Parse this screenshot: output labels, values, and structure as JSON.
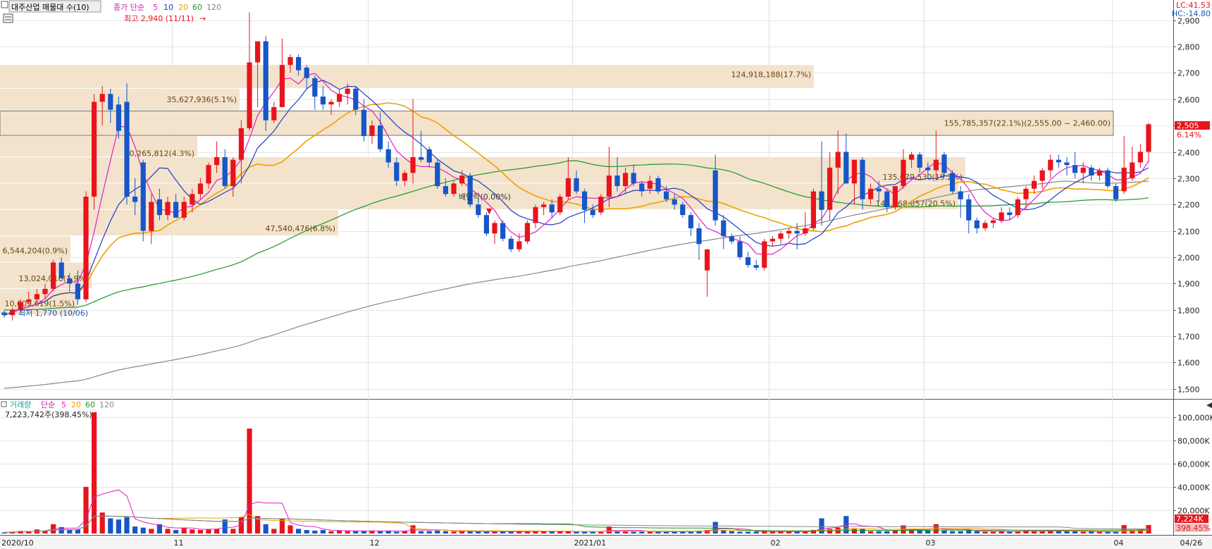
{
  "header": {
    "title": "대주산업 매물대 수(10)",
    "ma_prefix": "종가 단순",
    "ma_periods": [
      "5",
      "10",
      "20",
      "60",
      "120"
    ],
    "high_label": "최고 2,940 (11/11)",
    "low_label": "최저 1,770 (10/06)",
    "lc": "LC:41.53",
    "hc": "HC:-14.80",
    "dividend": "배당락(0.00%)"
  },
  "volume_header": {
    "label": "거래량",
    "ma_prefix": "단순",
    "ma_periods": [
      "5",
      "20",
      "60",
      "120"
    ],
    "last": "7,223,742주(398.45%)"
  },
  "price_axis": {
    "ticks": [
      "2,900",
      "2,800",
      "2,700",
      "2,600",
      "2,500",
      "2,400",
      "2,300",
      "2,200",
      "2,100",
      "2,000",
      "1,900",
      "1,800",
      "1,700",
      "1,600",
      "1,500"
    ],
    "current_price": "2,505",
    "current_change": "6.14%"
  },
  "volume_axis": {
    "ticks": [
      "100,000K",
      "80,000K",
      "60,000K",
      "40,000K",
      "20,000K"
    ],
    "current_volume": "7,224K",
    "current_ratio": "398.45%"
  },
  "time_axis": [
    "2020/10",
    "11",
    "12",
    "2021/01",
    "02",
    "03",
    "04",
    "04/26"
  ],
  "volume_profile": [
    {
      "label": "124,918,188(17.7%)"
    },
    {
      "label": "155,785,357(22.1%)(2,555.00 ~ 2,460.00)"
    },
    {
      "label": "35,627,936(5.1%)"
    },
    {
      "label": "30,265,812(4.3%)"
    },
    {
      "label": "135,079,530(19.2%)"
    },
    {
      "label": "144,568,857(20.5%)"
    },
    {
      "label": "47,540,476(6.8%)"
    },
    {
      "label": "6,544,204(0.9%)"
    },
    {
      "label": "13,024,016(1.9%)"
    },
    {
      "label": "10,609,619(1.5%)"
    }
  ],
  "colors": {
    "up": "#e8141c",
    "down": "#1656c8",
    "ma5": "#e020c8",
    "ma10": "#1e3cc8",
    "ma20": "#f0a000",
    "ma60": "#1a9a2a",
    "ma120": "#888888",
    "profile": "#f3e3cc"
  },
  "chart_data": {
    "type": "candlestick",
    "price_range": [
      1470,
      2950
    ],
    "volume_range_k": [
      0,
      110000
    ],
    "candles": [
      [
        1790,
        1800,
        1770,
        1780
      ],
      [
        1780,
        1810,
        1760,
        1800
      ],
      [
        1800,
        1840,
        1790,
        1830
      ],
      [
        1830,
        1870,
        1820,
        1840
      ],
      [
        1840,
        1880,
        1830,
        1860
      ],
      [
        1860,
        1900,
        1840,
        1880
      ],
      [
        1880,
        1990,
        1870,
        1980
      ],
      [
        1980,
        2000,
        1920,
        1920
      ],
      [
        1920,
        1940,
        1870,
        1900
      ],
      [
        1900,
        1950,
        1820,
        1840
      ],
      [
        1840,
        2250,
        1830,
        2230
      ],
      [
        2230,
        2620,
        2180,
        2590
      ],
      [
        2590,
        2650,
        2500,
        2620
      ],
      [
        2620,
        2640,
        2510,
        2560
      ],
      [
        2580,
        2610,
        2450,
        2480
      ],
      [
        2590,
        2660,
        2200,
        2230
      ],
      [
        2230,
        2300,
        2160,
        2210
      ],
      [
        2360,
        2370,
        2060,
        2100
      ],
      [
        2100,
        2240,
        2050,
        2210
      ],
      [
        2220,
        2260,
        2140,
        2160
      ],
      [
        2160,
        2230,
        2140,
        2210
      ],
      [
        2210,
        2240,
        2150,
        2150
      ],
      [
        2150,
        2230,
        2140,
        2210
      ],
      [
        2200,
        2260,
        2170,
        2240
      ],
      [
        2240,
        2300,
        2220,
        2280
      ],
      [
        2280,
        2360,
        2260,
        2350
      ],
      [
        2350,
        2440,
        2320,
        2380
      ],
      [
        2380,
        2410,
        2260,
        2270
      ],
      [
        2270,
        2380,
        2230,
        2370
      ],
      [
        2370,
        2520,
        2280,
        2490
      ],
      [
        2490,
        2930,
        2480,
        2740
      ],
      [
        2740,
        2760,
        2570,
        2820
      ],
      [
        2820,
        2840,
        2480,
        2520
      ],
      [
        2520,
        2590,
        2510,
        2570
      ],
      [
        2570,
        2830,
        2580,
        2730
      ],
      [
        2730,
        2770,
        2700,
        2760
      ],
      [
        2760,
        2770,
        2690,
        2710
      ],
      [
        2720,
        2730,
        2640,
        2680
      ],
      [
        2680,
        2690,
        2560,
        2610
      ],
      [
        2610,
        2650,
        2560,
        2580
      ],
      [
        2580,
        2600,
        2540,
        2590
      ],
      [
        2590,
        2640,
        2570,
        2620
      ],
      [
        2620,
        2660,
        2580,
        2640
      ],
      [
        2640,
        2650,
        2540,
        2560
      ],
      [
        2560,
        2600,
        2440,
        2460
      ],
      [
        2460,
        2520,
        2430,
        2500
      ],
      [
        2500,
        2550,
        2400,
        2410
      ],
      [
        2410,
        2440,
        2340,
        2360
      ],
      [
        2360,
        2380,
        2270,
        2290
      ],
      [
        2290,
        2330,
        2270,
        2320
      ],
      [
        2320,
        2600,
        2280,
        2380
      ],
      [
        2380,
        2480,
        2360,
        2370
      ],
      [
        2410,
        2420,
        2340,
        2360
      ],
      [
        2360,
        2370,
        2260,
        2270
      ],
      [
        2270,
        2300,
        2230,
        2240
      ],
      [
        2240,
        2290,
        2230,
        2280
      ],
      [
        2280,
        2330,
        2270,
        2310
      ],
      [
        2310,
        2320,
        2190,
        2200
      ],
      [
        2200,
        2220,
        2150,
        2160
      ],
      [
        2160,
        2170,
        2080,
        2090
      ],
      [
        2090,
        2140,
        2050,
        2130
      ],
      [
        2130,
        2140,
        2060,
        2070
      ],
      [
        2070,
        2080,
        2020,
        2030
      ],
      [
        2030,
        2090,
        2020,
        2060
      ],
      [
        2060,
        2140,
        2050,
        2130
      ],
      [
        2130,
        2200,
        2110,
        2190
      ],
      [
        2190,
        2210,
        2160,
        2200
      ],
      [
        2200,
        2220,
        2150,
        2170
      ],
      [
        2170,
        2240,
        2160,
        2230
      ],
      [
        2230,
        2380,
        2220,
        2300
      ],
      [
        2300,
        2330,
        2240,
        2250
      ],
      [
        2250,
        2260,
        2130,
        2180
      ],
      [
        2180,
        2200,
        2150,
        2160
      ],
      [
        2170,
        2240,
        2160,
        2230
      ],
      [
        2230,
        2420,
        2190,
        2310
      ],
      [
        2310,
        2380,
        2250,
        2270
      ],
      [
        2270,
        2340,
        2240,
        2320
      ],
      [
        2320,
        2350,
        2270,
        2280
      ],
      [
        2280,
        2290,
        2230,
        2250
      ],
      [
        2260,
        2310,
        2240,
        2290
      ],
      [
        2300,
        2310,
        2240,
        2250
      ],
      [
        2250,
        2270,
        2210,
        2220
      ],
      [
        2220,
        2240,
        2180,
        2200
      ],
      [
        2200,
        2210,
        2150,
        2160
      ],
      [
        2160,
        2170,
        2080,
        2110
      ],
      [
        2110,
        2130,
        1990,
        2050
      ],
      [
        1950,
        2030,
        1850,
        2030
      ],
      [
        2330,
        2390,
        2120,
        2140
      ],
      [
        2140,
        2160,
        2030,
        2080
      ],
      [
        2080,
        2090,
        2050,
        2060
      ],
      [
        2060,
        2080,
        1990,
        2000
      ],
      [
        2000,
        2020,
        1960,
        1970
      ],
      [
        1970,
        1990,
        1950,
        1960
      ],
      [
        1960,
        2070,
        1950,
        2060
      ],
      [
        2060,
        2080,
        2040,
        2070
      ],
      [
        2070,
        2100,
        2050,
        2090
      ],
      [
        2090,
        2110,
        2070,
        2100
      ],
      [
        2100,
        2130,
        2030,
        2090
      ],
      [
        2090,
        2170,
        2080,
        2110
      ],
      [
        2110,
        2260,
        2100,
        2250
      ],
      [
        2250,
        2440,
        2120,
        2180
      ],
      [
        2180,
        2400,
        2140,
        2340
      ],
      [
        2340,
        2480,
        2240,
        2400
      ],
      [
        2400,
        2470,
        2280,
        2280
      ],
      [
        2280,
        2370,
        2200,
        2370
      ],
      [
        2370,
        2380,
        2180,
        2220
      ],
      [
        2220,
        2280,
        2200,
        2260
      ],
      [
        2260,
        2290,
        2210,
        2250
      ],
      [
        2250,
        2260,
        2170,
        2190
      ],
      [
        2190,
        2270,
        2180,
        2270
      ],
      [
        2270,
        2410,
        2260,
        2370
      ],
      [
        2370,
        2400,
        2340,
        2390
      ],
      [
        2390,
        2400,
        2320,
        2340
      ],
      [
        2340,
        2360,
        2300,
        2330
      ],
      [
        2330,
        2480,
        2290,
        2370
      ],
      [
        2390,
        2400,
        2310,
        2320
      ],
      [
        2320,
        2330,
        2240,
        2250
      ],
      [
        2250,
        2270,
        2150,
        2220
      ],
      [
        2220,
        2240,
        2090,
        2140
      ],
      [
        2140,
        2150,
        2090,
        2110
      ],
      [
        2110,
        2140,
        2100,
        2130
      ],
      [
        2130,
        2150,
        2110,
        2140
      ],
      [
        2140,
        2190,
        2130,
        2170
      ],
      [
        2170,
        2190,
        2140,
        2160
      ],
      [
        2160,
        2230,
        2150,
        2220
      ],
      [
        2220,
        2270,
        2180,
        2260
      ],
      [
        2260,
        2310,
        2240,
        2290
      ],
      [
        2290,
        2340,
        2260,
        2330
      ],
      [
        2330,
        2390,
        2300,
        2370
      ],
      [
        2370,
        2390,
        2340,
        2360
      ],
      [
        2360,
        2380,
        2310,
        2350
      ],
      [
        2350,
        2400,
        2300,
        2320
      ],
      [
        2320,
        2360,
        2280,
        2340
      ],
      [
        2340,
        2350,
        2290,
        2310
      ],
      [
        2310,
        2340,
        2290,
        2330
      ],
      [
        2330,
        2340,
        2260,
        2270
      ],
      [
        2270,
        2280,
        2210,
        2220
      ],
      [
        2250,
        2460,
        2240,
        2340
      ],
      [
        2300,
        2420,
        2290,
        2360
      ],
      [
        2360,
        2430,
        2340,
        2400
      ],
      [
        2400,
        2510,
        2360,
        2505
      ]
    ],
    "volumes_k": [
      900,
      1500,
      2200,
      2000,
      3500,
      2500,
      8000,
      5500,
      3500,
      3500,
      40000,
      104000,
      18000,
      13000,
      12000,
      14000,
      6000,
      5000,
      4000,
      8000,
      4000,
      3000,
      5000,
      3500,
      3000,
      3500,
      4000,
      12000,
      4000,
      14000,
      90000,
      15000,
      8000,
      4000,
      13000,
      7000,
      4000,
      3000,
      2500,
      3000,
      2000,
      2500,
      2000,
      2000,
      2000,
      2500,
      2000,
      2500,
      1500,
      2000,
      7000,
      2000,
      2000,
      2500,
      2000,
      1500,
      1800,
      2000,
      1500,
      2000,
      1800,
      1500,
      1500,
      1500,
      2000,
      2500,
      1500,
      1500,
      1800,
      2000,
      1500,
      1500,
      1500,
      2000,
      6000,
      2000,
      2000,
      1500,
      1500,
      1500,
      1500,
      1500,
      1500,
      1500,
      2000,
      2500,
      3000,
      10000,
      3000,
      2000,
      1500,
      1500,
      1500,
      2500,
      1500,
      1500,
      1500,
      1500,
      2000,
      3000,
      13000,
      4000,
      5000,
      15000,
      4500,
      4000,
      2000,
      2000,
      2000,
      2500,
      7000,
      3000,
      2500,
      2500,
      8000,
      2500,
      2000,
      2000,
      3000,
      2000,
      1500,
      1500,
      2000,
      1500,
      2000,
      2500,
      2000,
      2000,
      2500,
      2000,
      2000,
      2000,
      1500,
      1500,
      1500,
      1500,
      1500,
      7200,
      3000,
      3000,
      7224
    ]
  }
}
